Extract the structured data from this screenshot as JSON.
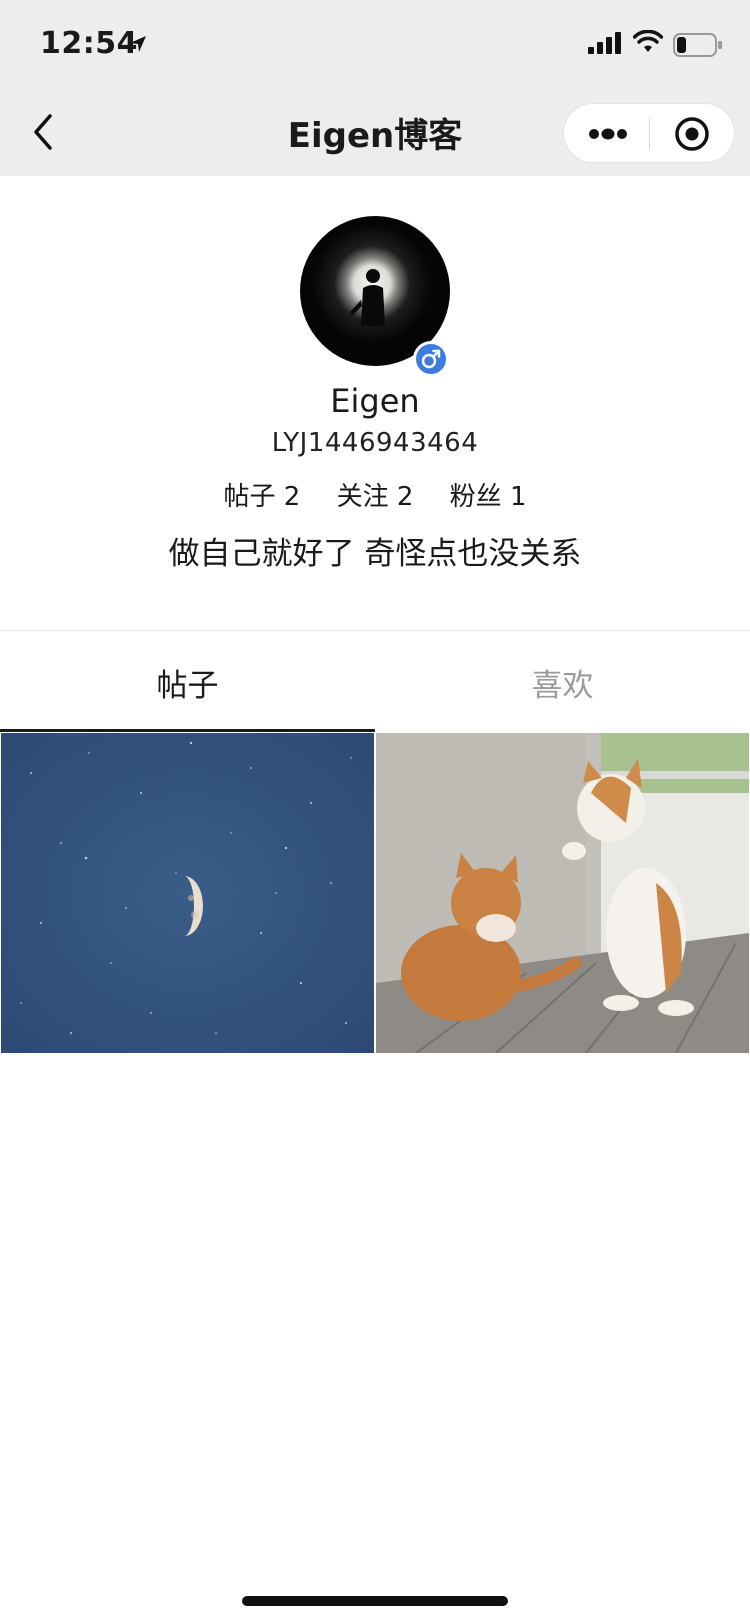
{
  "status_bar": {
    "time": "12:54",
    "icons": [
      "location-arrow-icon",
      "signal-icon",
      "wifi-icon",
      "battery-icon"
    ]
  },
  "nav": {
    "title": "Eigen博客",
    "icons": [
      "back-icon",
      "more-icon",
      "close-icon"
    ]
  },
  "profile": {
    "username": "Eigen",
    "user_id": "LYJ1446943464",
    "gender_icon": "male-icon",
    "stats": [
      {
        "label": "帖子",
        "count": "2"
      },
      {
        "label": "关注",
        "count": "2"
      },
      {
        "label": "粉丝",
        "count": "1"
      }
    ],
    "bio": "做自己就好了 奇怪点也没关系"
  },
  "tabs": [
    {
      "label": "帖子",
      "active": true
    },
    {
      "label": "喜欢",
      "active": false
    }
  ],
  "posts": [
    {
      "image": "moon-night-sky-image"
    },
    {
      "image": "two-cats-image"
    }
  ],
  "colors": {
    "header_bg": "#ededed",
    "badge_blue": "#3d7bdf",
    "inactive_tab": "#9a9a9a",
    "moon_sky": "#31527c"
  }
}
